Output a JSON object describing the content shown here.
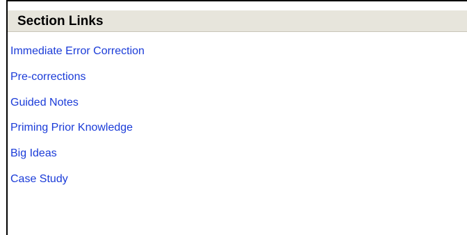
{
  "section": {
    "title": "Section Links",
    "links": [
      "Immediate Error Correction",
      "Pre-corrections",
      "Guided Notes",
      "Priming Prior Knowledge",
      "Big Ideas",
      "Case Study"
    ]
  },
  "colors": {
    "header_background": "#e7e5dc",
    "link": "#1a3bd8",
    "border": "#000000"
  }
}
